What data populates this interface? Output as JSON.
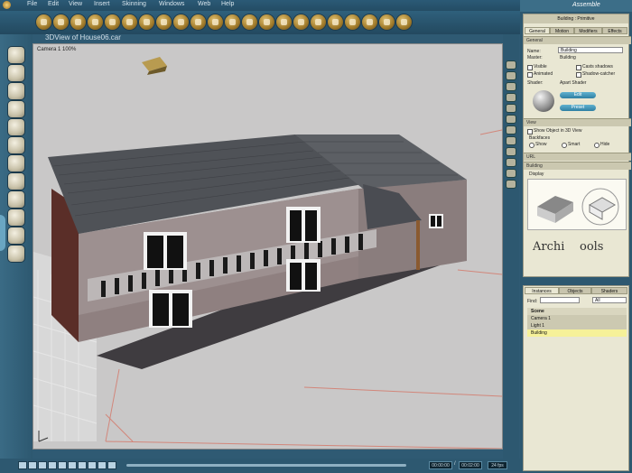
{
  "menu": [
    "File",
    "Edit",
    "View",
    "Insert",
    "Skinning",
    "Windows",
    "Web",
    "Help"
  ],
  "toolbar_icons": [
    "new-icon",
    "open-icon",
    "save-icon",
    "print-icon",
    "undo-icon",
    "redo-icon",
    "cut-icon",
    "copy-icon",
    "paste-icon",
    "delete-icon",
    "select-icon",
    "move-icon",
    "rotate-icon",
    "scale-icon",
    "light-icon",
    "camera-icon",
    "render-icon",
    "material-icon",
    "texture-icon",
    "animate-icon",
    "script-icon",
    "info-icon"
  ],
  "viewport": {
    "title": "3DView of House06.car",
    "camera_label": "Camera 1 100%"
  },
  "assemble_label": "Assemble",
  "object_title": "Building : Primitive",
  "tabs": {
    "general": "General",
    "motion": "Motion",
    "modifiers": "Modifiers",
    "effects": "Effects"
  },
  "general": {
    "section": "General",
    "name_label": "Name:",
    "name_value": "Building",
    "master_label": "Master:",
    "master_value": "Building",
    "visible": "Visible",
    "casts_shadows": "Casts shadows",
    "animated": "Animated",
    "shadow_catcher": "Shadow-catcher",
    "shader_label": "Shader:",
    "shader_value": "Apart Shader",
    "edit_button": "Edit",
    "preset_button": "Preset"
  },
  "view": {
    "section": "View",
    "show_in_3d": "Show Object in 3D View",
    "backfaces": "Backfaces",
    "show": "Show",
    "smart": "Smart",
    "hide": "Hide"
  },
  "url_section": "URL",
  "building_section": "Building",
  "display_label": "Display",
  "logo_text": {
    "left": "Archi",
    "right": "ools"
  },
  "scene_tabs": {
    "instances": "Instances",
    "objects": "Objects",
    "shaders": "Shaders"
  },
  "find_label": "Find:",
  "find_filter": "All",
  "scene_list": [
    "Scene",
    "Camera 1",
    "Light 1",
    "Building"
  ],
  "timeline": {
    "start": "00:00:00",
    "end": "00:02:00",
    "fps": "24 fps",
    "separator": "/"
  },
  "colors": {
    "accent": "#2d5870",
    "panel": "#e9e7d3",
    "selected": "#f6f199"
  }
}
